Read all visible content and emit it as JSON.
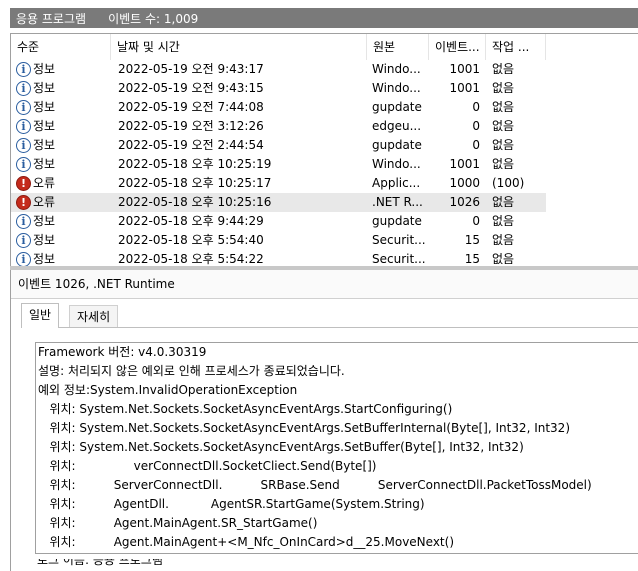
{
  "header": {
    "log_name": "응용 프로그램",
    "event_count": "이벤트 수: 1,009"
  },
  "columns": [
    "수준",
    "날짜 및 시간",
    "원본",
    "이벤트...",
    "작업 ..."
  ],
  "events": [
    {
      "level_icon": "info-icon",
      "level": "정보",
      "datetime": "2022-05-19 오전 9:43:17",
      "source": "Windo...",
      "id": "1001",
      "task": "없음"
    },
    {
      "level_icon": "info-icon",
      "level": "정보",
      "datetime": "2022-05-19 오전 9:43:15",
      "source": "Windo...",
      "id": "1001",
      "task": "없음"
    },
    {
      "level_icon": "info-icon",
      "level": "정보",
      "datetime": "2022-05-19 오전 7:44:08",
      "source": "gupdate",
      "id": "0",
      "task": "없음"
    },
    {
      "level_icon": "info-icon",
      "level": "정보",
      "datetime": "2022-05-19 오전 3:12:26",
      "source": "edgeu...",
      "id": "0",
      "task": "없음"
    },
    {
      "level_icon": "info-icon",
      "level": "정보",
      "datetime": "2022-05-19 오전 2:44:54",
      "source": "gupdate",
      "id": "0",
      "task": "없음"
    },
    {
      "level_icon": "info-icon",
      "level": "정보",
      "datetime": "2022-05-18 오후 10:25:19",
      "source": "Windo...",
      "id": "1001",
      "task": "없음"
    },
    {
      "level_icon": "error-icon",
      "level": "오류",
      "datetime": "2022-05-18 오후 10:25:17",
      "source": "Applic...",
      "id": "1000",
      "task": "(100)"
    },
    {
      "level_icon": "error-icon",
      "level": "오류",
      "datetime": "2022-05-18 오후 10:25:16",
      "source": ".NET R...",
      "id": "1026",
      "task": "없음",
      "selected": true
    },
    {
      "level_icon": "info-icon",
      "level": "정보",
      "datetime": "2022-05-18 오후 9:44:29",
      "source": "gupdate",
      "id": "0",
      "task": "없음"
    },
    {
      "level_icon": "info-icon",
      "level": "정보",
      "datetime": "2022-05-18 오후 5:54:40",
      "source": "Securit...",
      "id": "15",
      "task": "없음"
    },
    {
      "level_icon": "info-icon",
      "level": "정보",
      "datetime": "2022-05-18 오후 5:54:22",
      "source": "Securit...",
      "id": "15",
      "task": "없음"
    }
  ],
  "detail": {
    "title": "이벤트 1026, .NET Runtime",
    "tabs": [
      "일반",
      "자세히"
    ],
    "lines": [
      "Framework 버전: v4.0.30319",
      "설명: 처리되지 않은 예외로 인해 프로세스가 종료되었습니다.",
      "예외 정보:System.InvalidOperationException",
      "   위치: System.Net.Sockets.SocketAsyncEventArgs.StartConfiguring()",
      "   위치: System.Net.Sockets.SocketAsyncEventArgs.SetBufferInternal(Byte[], Int32, Int32)",
      "   위치: System.Net.Sockets.SocketAsyncEventArgs.SetBuffer(Byte[], Int32, Int32)",
      "   위치:          ServerConnectDll.SocketCliect.Send(Byte[])",
      "   위치:          ServerConnectDll.          SRBase.Send          ServerConnectDll.PacketTossModel)",
      "   위치:          AgentDll.           AgentSR.StartGame(System.String)",
      "   위치:          Agent.MainAgent.SR_StartGame()",
      "   위치:          Agent.MainAgent+<M_Nfc_OnInCard>d__25.MoveNext()"
    ],
    "cut_line": "로그 이름:          응용 프로그램"
  },
  "colors": {
    "header_bar": "#7a7a7a",
    "selected_row": "#e8e8e8",
    "info_icon": "#2a5d9f",
    "error_icon": "#c42b1c"
  }
}
